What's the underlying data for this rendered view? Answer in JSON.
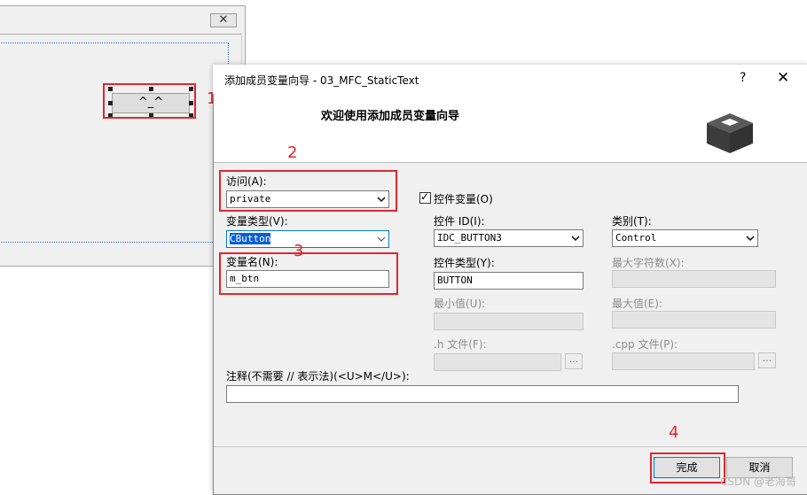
{
  "background_dialog": {
    "close_glyph": "✕",
    "button_label": "^_^"
  },
  "annotations": [
    "1",
    "2",
    "3",
    "4"
  ],
  "wizard": {
    "title": "添加成员变量向导 - 03_MFC_StaticText",
    "help_glyph": "?",
    "close_glyph": "✕",
    "heading": "欢迎使用添加成员变量向导",
    "access": {
      "label": "访问(A):",
      "value": "private"
    },
    "control_variable": {
      "label": "控件变量(O)",
      "checked": true,
      "check_glyph": "✓"
    },
    "variable_type": {
      "label": "变量类型(V):",
      "value": "CButton"
    },
    "variable_name": {
      "label": "变量名(N):",
      "value": "m_btn"
    },
    "control_id": {
      "label": "控件 ID(I):",
      "value": "IDC_BUTTON3"
    },
    "category": {
      "label": "类别(T):",
      "value": "Control"
    },
    "control_type": {
      "label": "控件类型(Y):",
      "value": "BUTTON"
    },
    "max_chars": {
      "label": "最大字符数(X):",
      "value": ""
    },
    "min_value": {
      "label": "最小值(U):",
      "value": ""
    },
    "max_value": {
      "label": "最大值(E):",
      "value": ""
    },
    "h_file": {
      "label": ".h 文件(F):",
      "value": "",
      "browse": "..."
    },
    "cpp_file": {
      "label": ".cpp 文件(P):",
      "value": "",
      "browse": "..."
    },
    "comment": {
      "label": "注释(不需要 // 表示法)(<U>M</U>):",
      "value": ""
    },
    "finish_label": "完成",
    "cancel_label": "取消"
  },
  "watermark": "CSDN @老海哥",
  "colors": {
    "annotation_red": "#e0262b",
    "selection_blue": "#0a5ed7",
    "dialog_bg": "#f0f0f0"
  }
}
